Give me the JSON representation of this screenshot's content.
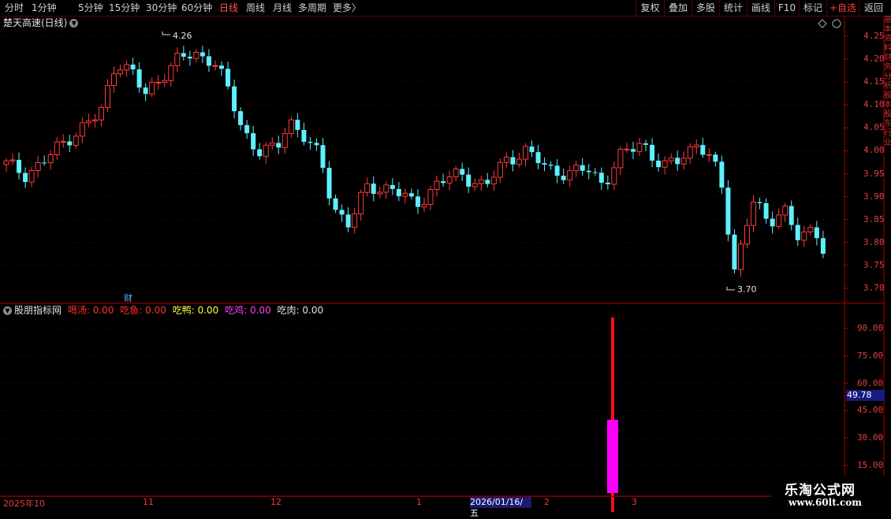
{
  "toolbar": {
    "periods": [
      {
        "label": "分时",
        "active": false
      },
      {
        "label": "1分钟",
        "active": false
      },
      {
        "label": "5分钟",
        "active": false
      },
      {
        "label": "15分钟",
        "active": false
      },
      {
        "label": "30分钟",
        "active": false
      },
      {
        "label": "60分钟",
        "active": false
      },
      {
        "label": "日线",
        "active": true
      },
      {
        "label": "周线",
        "active": false
      },
      {
        "label": "月线",
        "active": false
      },
      {
        "label": "多周期",
        "active": false
      },
      {
        "label": "更多",
        "active": false
      }
    ],
    "more_arrow": "〉",
    "right_buttons": [
      "复权",
      "叠加",
      "多股",
      "统计",
      "画线",
      "F10",
      "标记",
      "+自选",
      "返回"
    ]
  },
  "main_chart": {
    "title": "楚天高速(日线)",
    "high_label": "4.26",
    "low_label": "3.70",
    "cai_badge": "财",
    "price_ticks": [
      "4.25",
      "4.20",
      "4.15",
      "4.10",
      "4.05",
      "4.00",
      "3.95",
      "3.90",
      "3.85",
      "3.80",
      "3.75",
      "3.70"
    ],
    "colors": {
      "up": "#ff3b3b",
      "down": "#5ff0ff",
      "grid": "#5a0000",
      "axis": "#b00000"
    }
  },
  "indicator": {
    "name": "股朋指标网",
    "items": [
      {
        "label": "喝汤:",
        "value": "0.00",
        "color": "#ff3030"
      },
      {
        "label": "吃鱼:",
        "value": "0.00",
        "color": "#ff3030"
      },
      {
        "label": "吃鸭:",
        "value": "0.00",
        "color": "#ffff40"
      },
      {
        "label": "吃鸡:",
        "value": "0.00",
        "color": "#ff40ff"
      },
      {
        "label": "吃肉:",
        "value": "0.00",
        "color": "#e0e0e0"
      }
    ],
    "ticks": [
      "90.00",
      "75.00",
      "60.00",
      "45.00",
      "30.00",
      "15.00"
    ],
    "cursor_value": "49.78",
    "bars": [
      {
        "color": "#ff1010",
        "from": 0,
        "to": 96
      },
      {
        "color": "#ff00ff",
        "from": 0,
        "to": 40
      }
    ]
  },
  "date_axis": {
    "labels": [
      "2025年10",
      "11",
      "12",
      "1",
      "2",
      "3"
    ],
    "cursor_date": "2026/01/16/五"
  },
  "watermark": {
    "line1": "乐淘公式网",
    "line2": "www.60lt.com"
  },
  "right_strip_text": "基本资料财务分析股本股东行业"
}
